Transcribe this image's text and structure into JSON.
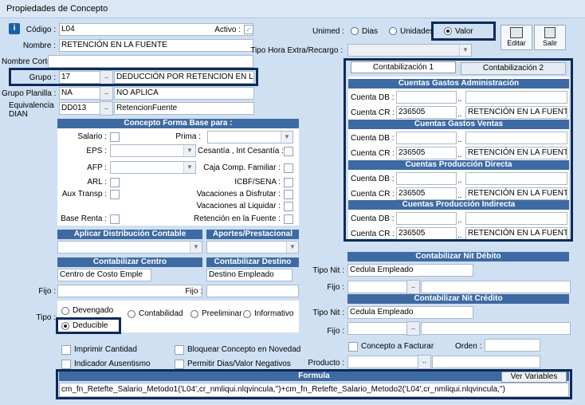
{
  "window": {
    "title": "Propiedades de Concepto"
  },
  "codigo": {
    "label": "Código :",
    "value": "L04"
  },
  "activo": {
    "label": "Activo :"
  },
  "unimed": {
    "label": "Unimed :",
    "options": [
      "Dias",
      "Unidades",
      "Valor"
    ],
    "selected": "Valor"
  },
  "toolbar": {
    "editar": "Editar",
    "salir": "Salir"
  },
  "nombre": {
    "label": "Nombre :",
    "value": "RETENCIÓN EN LA FUENTE"
  },
  "tipo_hora": {
    "label": "Tipo Hora Extra/Recargo :"
  },
  "nombre_corto": {
    "label": "Nombre Corto :"
  },
  "grupo": {
    "label": "Grupo :",
    "code": "17",
    "desc": "DEDUCCIÓN POR RETENCION EN LA FU"
  },
  "grupo_planilla": {
    "label": "Grupo Planilla :",
    "code": "NA",
    "desc": "NO APLICA"
  },
  "equivalencia": {
    "label1": "Equivalencia",
    "label2": "DIAN",
    "code": "DD013",
    "desc": "RetencionFuente"
  },
  "concepto_forma": {
    "header": "Concepto Forma Base para :",
    "salario": "Salario :",
    "prima": "Prima :",
    "eps": "EPS :",
    "cesantia": "Cesantía , Int Cesantía :",
    "afp": "AFP :",
    "caja": "Caja Comp. Familiar :",
    "arl": "ARL :",
    "icbf": "ICBF/SENA :",
    "aux": "Aux Transp :",
    "vac_disfrutar": "Vacaciones a Disfrutar :",
    "vac_liquidar": "Vacaciones al Liquidar :",
    "base_renta": "Base Renta :",
    "ret_fuente": "Retención en la Fuente :"
  },
  "contabilizacion": {
    "tabs": [
      "Contabilización 1",
      "Contabilización 2"
    ],
    "db_label": "Cuenta DB :",
    "cr_label": "Cuenta CR :",
    "sections": [
      {
        "title": "Cuentas Gastos Administración",
        "cr_code": "236505",
        "cr_desc": "RETENCIÓN EN LA FUENTE F"
      },
      {
        "title": "Cuentas Gastos Ventas",
        "cr_code": "236505",
        "cr_desc": "RETENCIÓN EN LA FUENTE F"
      },
      {
        "title": "Cuentas Producción Directa",
        "cr_code": "236505",
        "cr_desc": "RETENCIÓN EN LA FUENTE F"
      },
      {
        "title": "Cuentas Producción Indirecta",
        "cr_code": "236505",
        "cr_desc": "RETENCIÓN EN LA FUENTE F"
      }
    ]
  },
  "aplicar_dist": {
    "header": "Aplicar Distribución Contable"
  },
  "aportes": {
    "header": "Aportes/Prestacional"
  },
  "contab_centro": {
    "header": "Contabilizar Centro",
    "value": "Centro de Costo Emple",
    "fijo_label": "Fijo :"
  },
  "contab_destino": {
    "header": "Contabilizar Destino",
    "value": "Destino Empleado",
    "fijo_label": "Fijo :"
  },
  "nit_debito": {
    "header": "Contabilizar Nit Débito",
    "tipo_label": "Tipo Nit :",
    "tipo_value": "Cedula Empleado",
    "fijo_label": "Fijo :"
  },
  "nit_credito": {
    "header": "Contabilizar Nit Crédito",
    "tipo_label": "Tipo Nit :",
    "tipo_value": "Cedula Empleado",
    "fijo_label": "Fijo :"
  },
  "tipo": {
    "label": "Tipo :",
    "options": [
      "Devengado",
      "Contabilidad",
      "Preeliminar",
      "Informativo",
      "Deducible"
    ],
    "selected": "Deducible"
  },
  "concepto_facturar": {
    "label": "Concepto a Facturar",
    "orden_label": "Orden :"
  },
  "checks": {
    "imprimir": "Imprimir Cantidad",
    "bloquear": "Bloquear Concepto en Novedad",
    "indicador": "Indicador Ausentismo",
    "permitir": "Permitir Dias/Valor Negativos"
  },
  "producto": {
    "label": "Producto :"
  },
  "formula": {
    "header": "Formula",
    "ver_variables": "Ver Variables",
    "value": "cm_fn_Retefte_Salario_Metodo1('L04',cr_nmliqui.nlqvincula,'')+cm_fn_Retefte_Salario_Metodo2('L04',cr_nmliqui.nlqvincula,'')"
  }
}
